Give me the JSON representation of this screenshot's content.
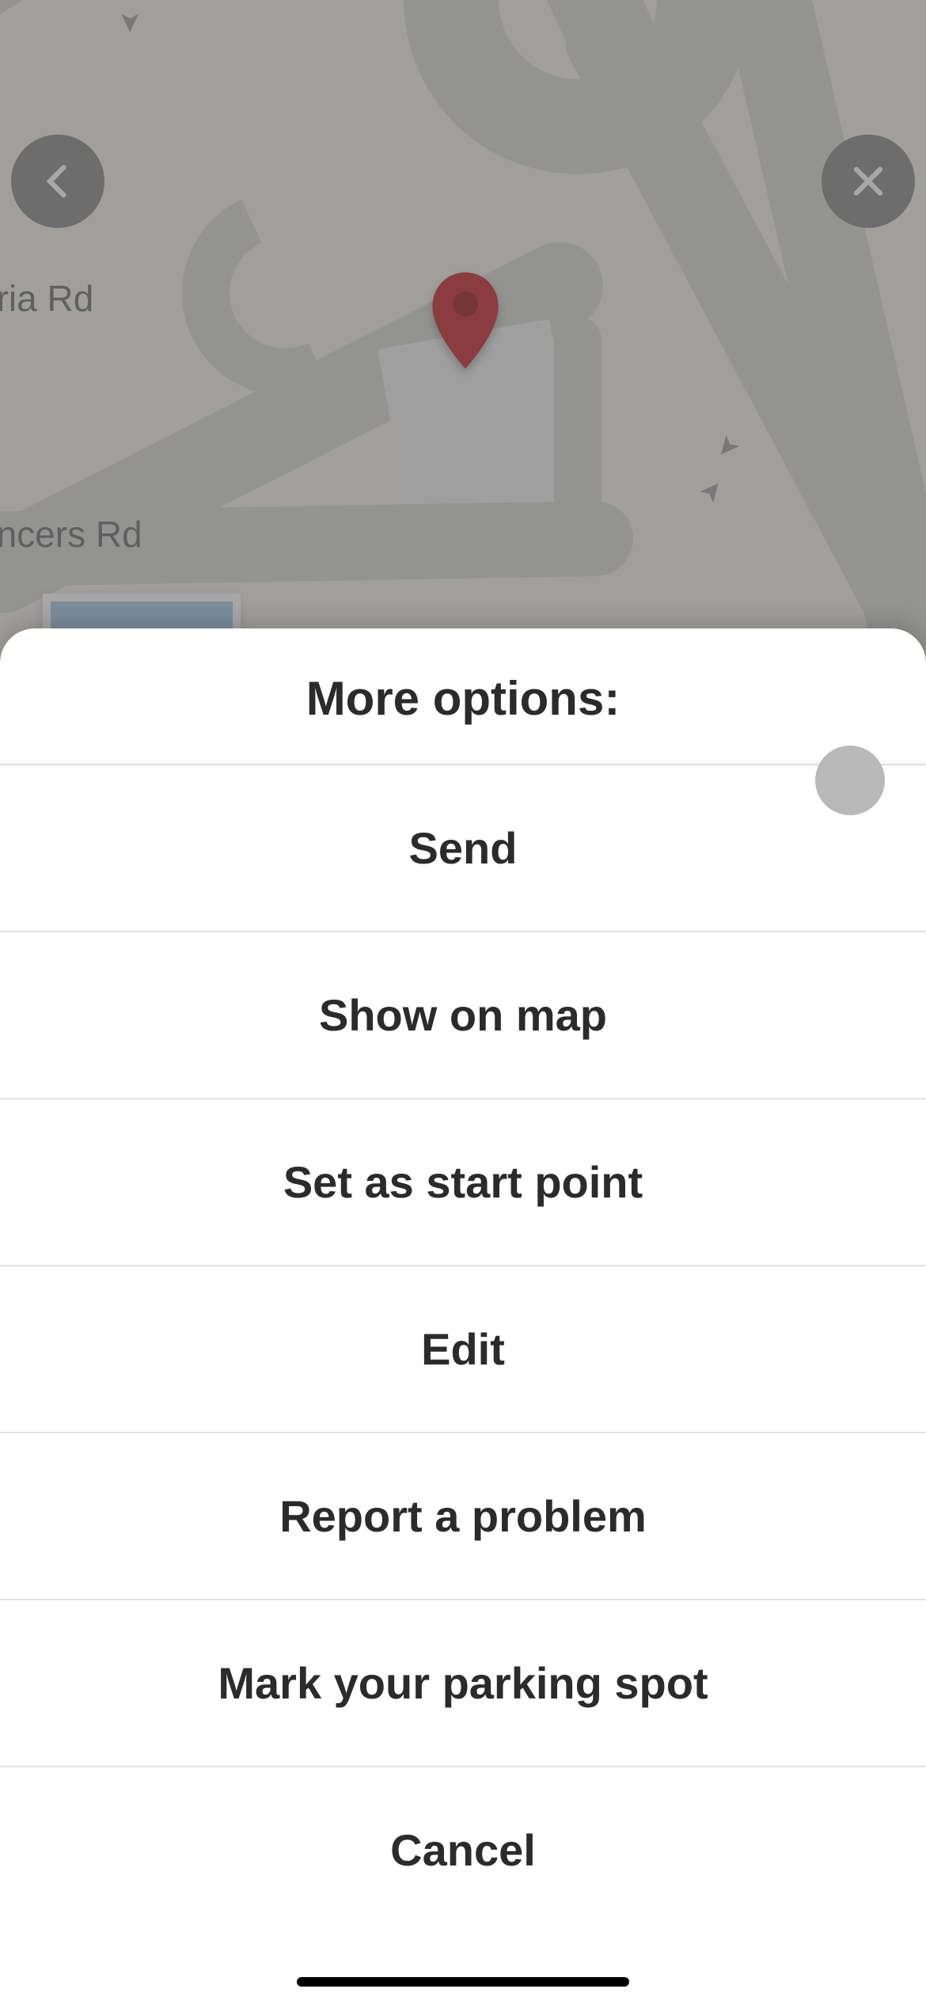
{
  "map": {
    "road_labels": {
      "victoria": "oria Rd",
      "spencers": "encers Rd"
    },
    "pin_color": "#c6282e"
  },
  "nav": {
    "back_name": "back",
    "close_name": "close"
  },
  "sheet": {
    "title": "More options:",
    "options": [
      {
        "label": "Send"
      },
      {
        "label": "Show on map"
      },
      {
        "label": "Set as start point"
      },
      {
        "label": "Edit"
      },
      {
        "label": "Report a problem"
      },
      {
        "label": "Mark your parking spot"
      },
      {
        "label": "Cancel"
      }
    ]
  }
}
